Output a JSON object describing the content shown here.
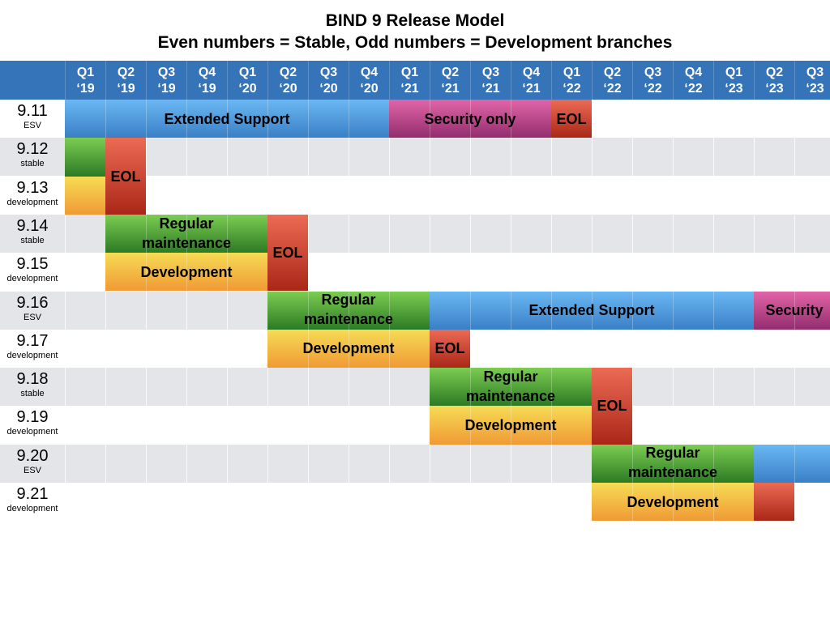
{
  "chart_data": {
    "type": "gantt",
    "title": "BIND 9 Release Model",
    "subtitle": "Even numbers = Stable, Odd numbers = Development branches",
    "quarters": [
      {
        "q": "Q1",
        "y": "‘19"
      },
      {
        "q": "Q2",
        "y": "‘19"
      },
      {
        "q": "Q3",
        "y": "‘19"
      },
      {
        "q": "Q4",
        "y": "‘19"
      },
      {
        "q": "Q1",
        "y": "‘20"
      },
      {
        "q": "Q2",
        "y": "‘20"
      },
      {
        "q": "Q3",
        "y": "‘20"
      },
      {
        "q": "Q4",
        "y": "‘20"
      },
      {
        "q": "Q1",
        "y": "‘21"
      },
      {
        "q": "Q2",
        "y": "‘21"
      },
      {
        "q": "Q3",
        "y": "‘21"
      },
      {
        "q": "Q4",
        "y": "‘21"
      },
      {
        "q": "Q1",
        "y": "‘22"
      },
      {
        "q": "Q2",
        "y": "‘22"
      },
      {
        "q": "Q3",
        "y": "‘22"
      },
      {
        "q": "Q4",
        "y": "‘22"
      },
      {
        "q": "Q1",
        "y": "‘23"
      },
      {
        "q": "Q2",
        "y": "‘23"
      },
      {
        "q": "Q3",
        "y": "‘23"
      }
    ],
    "rows": [
      {
        "version": "9.11",
        "type": "ESV"
      },
      {
        "version": "9.12",
        "type": "stable"
      },
      {
        "version": "9.13",
        "type": "development"
      },
      {
        "version": "9.14",
        "type": "stable"
      },
      {
        "version": "9.15",
        "type": "development"
      },
      {
        "version": "9.16",
        "type": "ESV"
      },
      {
        "version": "9.17",
        "type": "development"
      },
      {
        "version": "9.18",
        "type": "stable"
      },
      {
        "version": "9.19",
        "type": "development"
      },
      {
        "version": "9.20",
        "type": "ESV"
      },
      {
        "version": "9.21",
        "type": "development"
      }
    ],
    "bars": [
      {
        "row": 0,
        "start": 0,
        "end": 8,
        "phase": "ext",
        "label": "Extended Support"
      },
      {
        "row": 0,
        "start": 8,
        "end": 12,
        "phase": "sec",
        "label": "Security only"
      },
      {
        "row": 0,
        "start": 12,
        "end": 13,
        "phase": "eol",
        "label": "EOL"
      },
      {
        "row": 1,
        "start": 0,
        "end": 1,
        "phase": "reg",
        "label": ""
      },
      {
        "row": 2,
        "start": 0,
        "end": 1,
        "phase": "dev",
        "label": ""
      },
      {
        "row": 1,
        "rowspan": 2,
        "start": 1,
        "end": 2,
        "phase": "eol",
        "label": "EOL"
      },
      {
        "row": 3,
        "start": 1,
        "end": 5,
        "phase": "reg",
        "label": "Regular maintenance"
      },
      {
        "row": 4,
        "start": 1,
        "end": 5,
        "phase": "dev",
        "label": "Development"
      },
      {
        "row": 3,
        "rowspan": 2,
        "start": 5,
        "end": 6,
        "phase": "eol",
        "label": "EOL"
      },
      {
        "row": 5,
        "start": 5,
        "end": 9,
        "phase": "reg",
        "label": "Regular maintenance"
      },
      {
        "row": 5,
        "start": 9,
        "end": 17,
        "phase": "ext",
        "label": "Extended Support"
      },
      {
        "row": 5,
        "start": 17,
        "end": 19,
        "phase": "sec",
        "label": "Security"
      },
      {
        "row": 6,
        "start": 5,
        "end": 9,
        "phase": "dev",
        "label": "Development"
      },
      {
        "row": 6,
        "start": 9,
        "end": 10,
        "phase": "eol",
        "label": "EOL"
      },
      {
        "row": 7,
        "start": 9,
        "end": 13,
        "phase": "reg",
        "label": "Regular maintenance"
      },
      {
        "row": 8,
        "start": 9,
        "end": 13,
        "phase": "dev",
        "label": "Development"
      },
      {
        "row": 7,
        "rowspan": 2,
        "start": 13,
        "end": 14,
        "phase": "eol",
        "label": "EOL"
      },
      {
        "row": 9,
        "start": 13,
        "end": 17,
        "phase": "reg",
        "label": "Regular maintenance"
      },
      {
        "row": 9,
        "start": 17,
        "end": 19,
        "phase": "ext",
        "label": ""
      },
      {
        "row": 10,
        "start": 13,
        "end": 17,
        "phase": "dev",
        "label": "Development"
      },
      {
        "row": 10,
        "start": 17,
        "end": 18,
        "phase": "eol",
        "label": ""
      }
    ],
    "legend": {
      "ext": "Extended Support",
      "sec": "Security only",
      "eol": "EOL",
      "reg": "Regular maintenance",
      "dev": "Development"
    },
    "colors": {
      "header": "#3574b8",
      "ext": "#4f97dc",
      "sec": "#c04b8e",
      "eol": "#d0432f",
      "reg": "#55a63b",
      "dev": "#f4c146",
      "shade": "#e4e5e9"
    }
  }
}
